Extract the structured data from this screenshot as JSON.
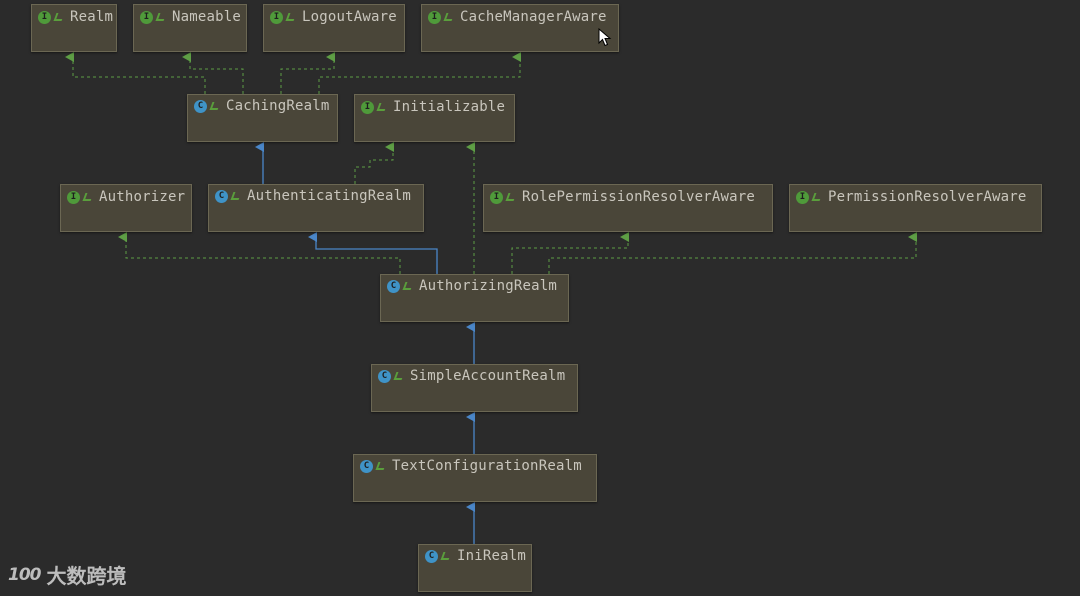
{
  "diagram": {
    "nodes": [
      {
        "id": "realm",
        "label": "Realm",
        "kind": "interface"
      },
      {
        "id": "nameable",
        "label": "Nameable",
        "kind": "interface"
      },
      {
        "id": "logoutaware",
        "label": "LogoutAware",
        "kind": "interface"
      },
      {
        "id": "cachemanageraware",
        "label": "CacheManagerAware",
        "kind": "interface"
      },
      {
        "id": "cachingrealm",
        "label": "CachingRealm",
        "kind": "abstract-class"
      },
      {
        "id": "initializable",
        "label": "Initializable",
        "kind": "interface"
      },
      {
        "id": "authorizer",
        "label": "Authorizer",
        "kind": "interface"
      },
      {
        "id": "authenticatingrealm",
        "label": "AuthenticatingRealm",
        "kind": "abstract-class"
      },
      {
        "id": "rolepermissionresolveraware",
        "label": "RolePermissionResolverAware",
        "kind": "interface"
      },
      {
        "id": "permissionresolveraware",
        "label": "PermissionResolverAware",
        "kind": "interface"
      },
      {
        "id": "authorizingrealm",
        "label": "AuthorizingRealm",
        "kind": "abstract-class"
      },
      {
        "id": "simpleaccountrealm",
        "label": "SimpleAccountRealm",
        "kind": "class"
      },
      {
        "id": "textconfigurationrealm",
        "label": "TextConfigurationRealm",
        "kind": "class"
      },
      {
        "id": "inirealm",
        "label": "IniRealm",
        "kind": "class"
      }
    ],
    "edges": [
      {
        "from": "cachingrealm",
        "to": "realm",
        "type": "implements"
      },
      {
        "from": "cachingrealm",
        "to": "nameable",
        "type": "implements"
      },
      {
        "from": "cachingrealm",
        "to": "logoutaware",
        "type": "implements"
      },
      {
        "from": "cachingrealm",
        "to": "cachemanageraware",
        "type": "implements"
      },
      {
        "from": "authenticatingrealm",
        "to": "cachingrealm",
        "type": "extends"
      },
      {
        "from": "authenticatingrealm",
        "to": "initializable",
        "type": "implements"
      },
      {
        "from": "authorizingrealm",
        "to": "authenticatingrealm",
        "type": "extends"
      },
      {
        "from": "authorizingrealm",
        "to": "authorizer",
        "type": "implements"
      },
      {
        "from": "authorizingrealm",
        "to": "initializable",
        "type": "implements"
      },
      {
        "from": "authorizingrealm",
        "to": "rolepermissionresolveraware",
        "type": "implements"
      },
      {
        "from": "authorizingrealm",
        "to": "permissionresolveraware",
        "type": "implements"
      },
      {
        "from": "simpleaccountrealm",
        "to": "authorizingrealm",
        "type": "extends"
      },
      {
        "from": "textconfigurationrealm",
        "to": "simpleaccountrealm",
        "type": "extends"
      },
      {
        "from": "inirealm",
        "to": "textconfigurationrealm",
        "type": "extends"
      }
    ]
  },
  "badges": {
    "interface": "I",
    "class": "C"
  },
  "colors": {
    "background": "#2b2b2b",
    "node_fill": "#4a4639",
    "extends_edge": "#4a86c8",
    "implements_edge": "#5e9e45",
    "interface_badge": "#4f9a3a",
    "class_badge": "#3f93c7"
  },
  "watermark": {
    "logo": "100",
    "text": "大数跨境"
  }
}
